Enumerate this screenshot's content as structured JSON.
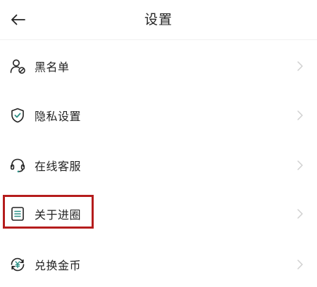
{
  "header": {
    "title": "设置",
    "back_icon": "arrow-left-icon"
  },
  "menu": {
    "items": [
      {
        "label": "黑名单",
        "icon": "user-block-icon"
      },
      {
        "label": "隐私设置",
        "icon": "shield-check-icon"
      },
      {
        "label": "在线客服",
        "icon": "headset-icon"
      },
      {
        "label": "关于进圈",
        "icon": "document-icon"
      },
      {
        "label": "兑换金币",
        "icon": "coin-exchange-icon"
      }
    ],
    "chevron_icon": "chevron-right-icon"
  },
  "highlight": {
    "target_item": 3,
    "color": "#b51c1c"
  },
  "colors": {
    "text": "#222222",
    "chevron": "#d0d0d0",
    "icon_accent": "#2a8f85"
  }
}
